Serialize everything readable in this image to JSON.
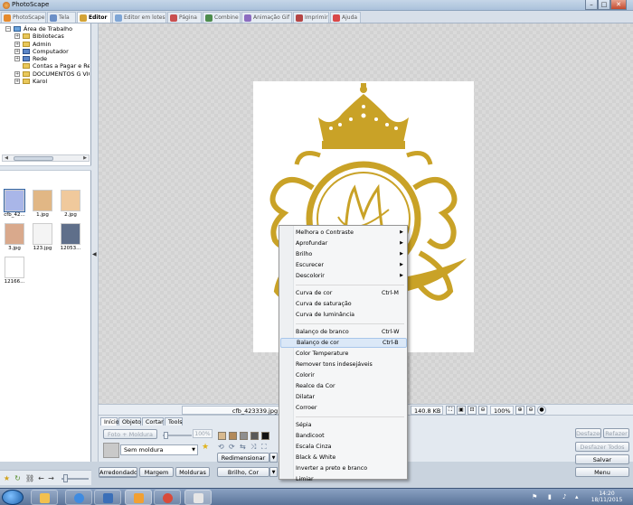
{
  "window": {
    "title": "PhotoScape",
    "controls": [
      "–",
      "□",
      "✕"
    ]
  },
  "tabs": [
    {
      "label": "PhotoScape",
      "icon": "photoscape-icon",
      "color": "#e58a2d"
    },
    {
      "label": "Tela",
      "icon": "screen-icon",
      "color": "#6b8fc7"
    },
    {
      "label": "Editor",
      "icon": "editor-icon",
      "color": "#d3a336",
      "active": true
    },
    {
      "label": "Editor em lotes",
      "icon": "batch-editor-icon",
      "color": "#7fa6d6"
    },
    {
      "label": "Página",
      "icon": "page-icon",
      "color": "#c94f4f"
    },
    {
      "label": "Combine",
      "icon": "combine-icon",
      "color": "#4d8c4d"
    },
    {
      "label": "Animação Gif",
      "icon": "animated-gif-icon",
      "color": "#8c6dc0"
    },
    {
      "label": "Imprimir",
      "icon": "print-icon",
      "color": "#b54545"
    },
    {
      "label": "Ajuda",
      "icon": "help-icon",
      "color": "#d94848"
    }
  ],
  "tree": [
    {
      "label": "Área de Trabalho",
      "level": 0,
      "expander": "⊟",
      "icon": "desktop"
    },
    {
      "label": "Bibliotecas",
      "level": 1,
      "expander": "⊞",
      "icon": "folder"
    },
    {
      "label": "Admin",
      "level": 1,
      "expander": "⊞",
      "icon": "folder"
    },
    {
      "label": "Computador",
      "level": 1,
      "expander": "⊞",
      "icon": "computer"
    },
    {
      "label": "Rede",
      "level": 1,
      "expander": "⊞",
      "icon": "network"
    },
    {
      "label": "Contas a Pagar e Rec",
      "level": 1,
      "expander": "",
      "icon": "folder"
    },
    {
      "label": "DOCUMENTOS G VIC",
      "level": 1,
      "expander": "⊞",
      "icon": "folder"
    },
    {
      "label": "Karol",
      "level": 1,
      "expander": "⊞",
      "icon": "folder"
    }
  ],
  "thumbnails": [
    {
      "caption": "cfb_42...",
      "color": "#a9b6e8",
      "selected": true
    },
    {
      "caption": "1.jpg",
      "color": "#e1b785"
    },
    {
      "caption": "2.jpg",
      "color": "#f0c99c"
    },
    {
      "caption": "3.jpg",
      "color": "#d9a98c"
    },
    {
      "caption": "123.jpg",
      "color": "#f4f4f4"
    },
    {
      "caption": "12053...",
      "color": "#5f6f8a"
    },
    {
      "caption": "12166...",
      "color": "#ffffff"
    }
  ],
  "status": {
    "filename": "cfb_423339.jpg",
    "filesize": "140.8 KB",
    "zoom": "100%"
  },
  "editor_tabs": [
    {
      "label": "Início",
      "active": true
    },
    {
      "label": "Objeto"
    },
    {
      "label": "Cortar"
    },
    {
      "label": "Tools"
    }
  ],
  "editor_panel": {
    "photo_frame_button": "Foto + Moldura",
    "frame_percent": "100%",
    "frame_select": "Sem moldura",
    "round_button": "Arredondado",
    "margin_button": "Margem",
    "frames_button": "Molduras",
    "resize_button": "Redimensionar",
    "brightness_button": "Brilho, Cor"
  },
  "right_buttons": {
    "undo": "Desfazer",
    "redo": "Refazer",
    "undo_all": "Desfazer Todos",
    "save": "Salvar",
    "menu": "Menu"
  },
  "context_menu": [
    {
      "label": "Melhora o Contraste",
      "submenu": true
    },
    {
      "label": "Aprofundar",
      "submenu": true
    },
    {
      "label": "Brilho",
      "submenu": true
    },
    {
      "label": "Escurecer",
      "submenu": true
    },
    {
      "label": "Descolorir",
      "submenu": true
    },
    {
      "separator": true
    },
    {
      "label": "Curva de cor",
      "shortcut": "Ctrl-M"
    },
    {
      "label": "Curva de saturação"
    },
    {
      "label": "Curva de luminância"
    },
    {
      "separator": true
    },
    {
      "label": "Balanço de branco",
      "shortcut": "Ctrl-W"
    },
    {
      "label": "Balanço de cor",
      "shortcut": "Ctrl-B",
      "hover": true
    },
    {
      "label": "Color Temperature"
    },
    {
      "label": "Remover tons indesejáveis"
    },
    {
      "label": "Colorir"
    },
    {
      "label": "Realce da Cor"
    },
    {
      "label": "Dilatar"
    },
    {
      "label": "Corroer"
    },
    {
      "separator": true
    },
    {
      "label": "Sépia"
    },
    {
      "label": "Bandicoot"
    },
    {
      "label": "Escala Cinza"
    },
    {
      "label": "Black & White"
    },
    {
      "label": "Inverter a preto e branco"
    },
    {
      "label": "Limiar"
    }
  ],
  "taskbar": {
    "apps": [
      {
        "name": "file-explorer-icon",
        "color": "#f2c04e"
      },
      {
        "name": "ie-icon",
        "color": "#3f8be0"
      },
      {
        "name": "app-icon",
        "color": "#3a6fb8"
      },
      {
        "name": "photoscape-taskbar-icon",
        "color": "#f1a033"
      },
      {
        "name": "chrome-icon",
        "color": "#d94b3b"
      },
      {
        "name": "paint-icon",
        "color": "#e6e6e6"
      }
    ],
    "time": "14:20",
    "date": "18/11/2015"
  },
  "colors": {
    "gold": "#c9a227",
    "accent": "#3366aa"
  }
}
